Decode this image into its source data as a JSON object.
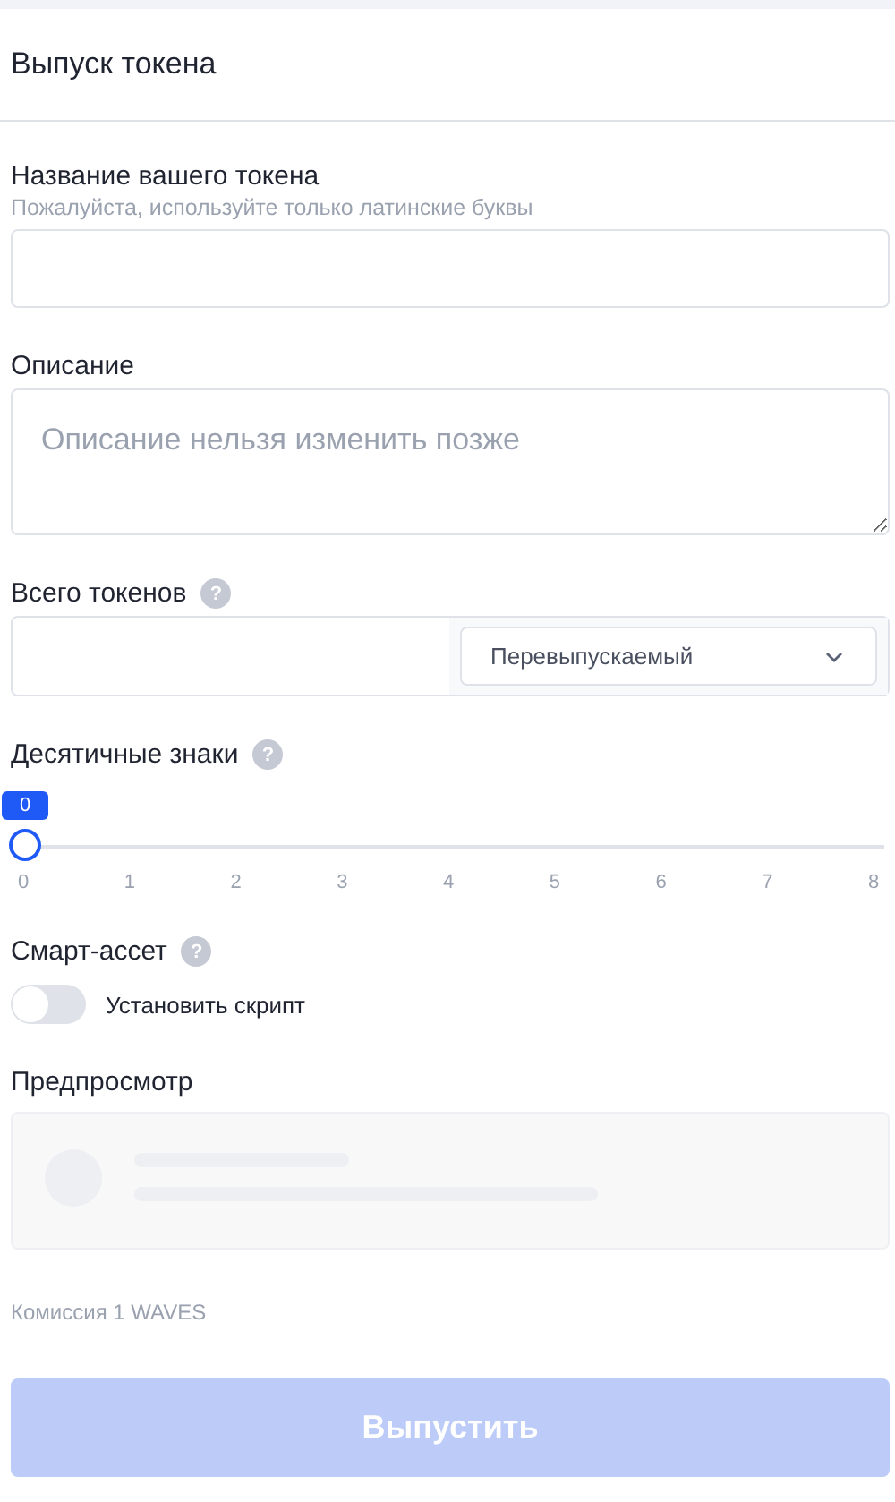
{
  "header": {
    "title": "Выпуск токена"
  },
  "name_field": {
    "label": "Название вашего токена",
    "hint": "Пожалуйста, используйте только латинские буквы"
  },
  "description_field": {
    "label": "Описание",
    "placeholder": "Описание нельзя изменить позже"
  },
  "total_field": {
    "label": "Всего токенов",
    "help": "?",
    "select": "Перевыпускаемый"
  },
  "decimals": {
    "label": "Десятичные знаки",
    "help": "?",
    "level": 0,
    "value": "0",
    "ticks": [
      "0",
      "1",
      "2",
      "3",
      "4",
      "5",
      "6",
      "7",
      "8"
    ]
  },
  "smart_asset": {
    "label": "Смарт-ассет",
    "help": "?",
    "toggle_label": "Установить скрипт",
    "on": false
  },
  "preview": {
    "label": "Предпросмотр"
  },
  "fee": "Комиссия 1 WAVES",
  "submit": {
    "label": "Выпустить",
    "disabled": true
  }
}
